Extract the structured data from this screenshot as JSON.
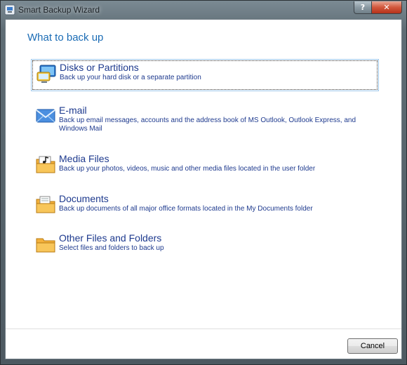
{
  "window": {
    "title": "Smart Backup Wizard",
    "help_label": "?",
    "close_label": "✕"
  },
  "heading": "What to back up",
  "options": [
    {
      "title": "Disks or Partitions",
      "description": "Back up your hard disk or a separate partition",
      "icon": "monitor-icon",
      "selected": true
    },
    {
      "title": "E-mail",
      "description": "Back up email messages, accounts and the address book of MS Outlook, Outlook Express, and Windows Mail",
      "icon": "envelope-icon",
      "selected": false
    },
    {
      "title": "Media Files",
      "description": "Back up your photos, videos, music and other media files located in the user folder",
      "icon": "media-folder-icon",
      "selected": false
    },
    {
      "title": "Documents",
      "description": "Back up documents of all major office formats located in the My Documents folder",
      "icon": "documents-folder-icon",
      "selected": false
    },
    {
      "title": "Other Files and Folders",
      "description": "Select files and folders to back up",
      "icon": "folder-icon",
      "selected": false
    }
  ],
  "footer": {
    "cancel_label": "Cancel"
  },
  "colors": {
    "heading": "#1b6cb5",
    "option_text": "#1e3a8e",
    "close_button": "#d2573c"
  }
}
